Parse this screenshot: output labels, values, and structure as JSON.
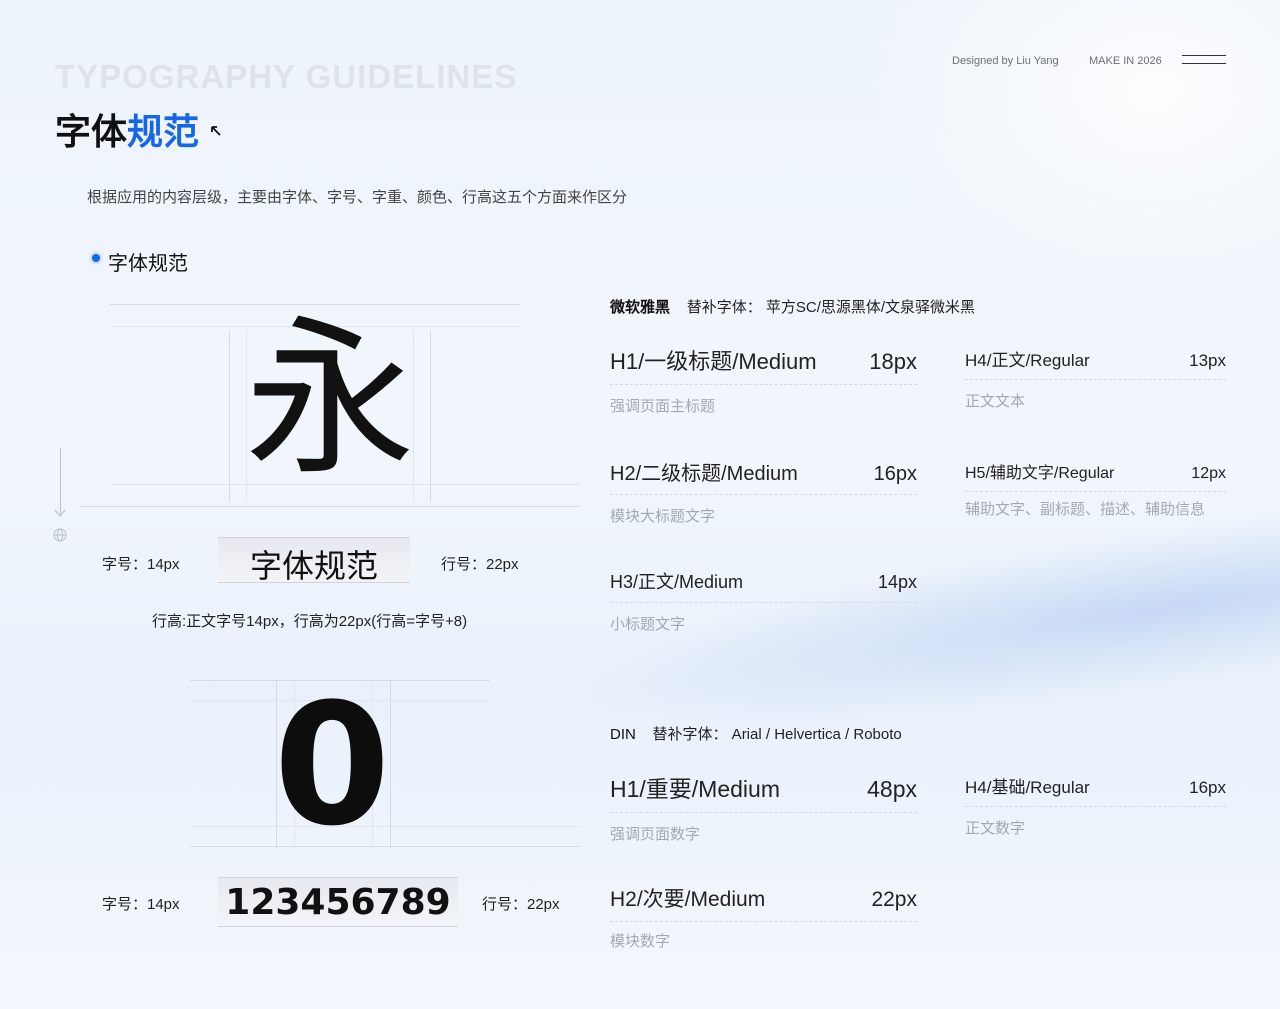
{
  "header": {
    "bg_title": "TYPOGRAPHY GUIDELINES",
    "title_black": "字体",
    "title_blue": "规范",
    "designer": "Designed by Liu Yang",
    "make": "MAKE IN 2026"
  },
  "intro": "根据应用的内容层级，主要由字体、字号、字重、颜色、行高这五个方面来作区分",
  "section_title": "字体规范",
  "demo_cn": {
    "glyph": "永",
    "size_label": "字号：14px",
    "sample": "字体规范",
    "line_label": "行号：22px",
    "rule": "行高:正文字号14px，行高为22px(行高=字号+8)"
  },
  "demo_num": {
    "glyph": "0",
    "size_label": "字号：14px",
    "sample": "123456789",
    "line_label": "行号：22px"
  },
  "font_cn": {
    "name": "微软雅黑",
    "alt": "替补字体：  苹方SC/思源黑体/文泉驿微米黑",
    "specs": [
      {
        "label": "H1/一级标题/Medium",
        "size": "18px",
        "desc": "强调页面主标题"
      },
      {
        "label": "H2/二级标题/Medium",
        "size": "16px",
        "desc": "模块大标题文字"
      },
      {
        "label": "H3/正文/Medium",
        "size": "14px",
        "desc": "小标题文字"
      },
      {
        "label": "H4/正文/Regular",
        "size": "13px",
        "desc": "正文文本"
      },
      {
        "label": "H5/辅助文字/Regular",
        "size": "12px",
        "desc": "辅助文字、副标题、描述、辅助信息"
      }
    ]
  },
  "font_din": {
    "name": "DIN",
    "alt": "替补字体：  Arial / Helvertica / Roboto",
    "specs": [
      {
        "label": "H1/重要/Medium",
        "size": "48px",
        "desc": "强调页面数字"
      },
      {
        "label": "H2/次要/Medium",
        "size": "22px",
        "desc": "模块数字"
      },
      {
        "label": "H4/基础/Regular",
        "size": "16px",
        "desc": "正文数字"
      }
    ]
  }
}
